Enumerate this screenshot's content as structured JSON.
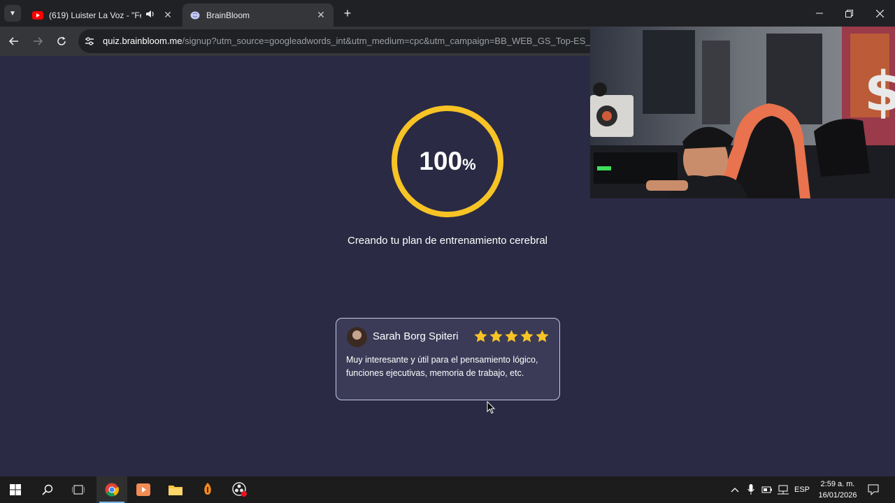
{
  "browser": {
    "tabs": [
      {
        "title": "(619) Luister La Voz - \"Feliz",
        "favicon": "youtube-icon",
        "audio": true,
        "active": false
      },
      {
        "title": "BrainBloom",
        "favicon": "brainbloom-icon",
        "audio": false,
        "active": true
      }
    ],
    "url": {
      "host": "quiz.brainbloom.me",
      "path": "/signup?utm_source=googleadwords_int&utm_medium=cpc&utm_campaign=BB_WEB_GS_Top-ES_t"
    }
  },
  "page": {
    "progress": {
      "value": 100,
      "number": "100",
      "unit": "%"
    },
    "status_text": "Creando tu plan de entrenamiento cerebral",
    "review": {
      "name": "Sarah Borg Spiteri",
      "rating": 5,
      "text": "Muy interesante y útil para el pensamiento lógico, funciones ejecutivas, memoria de trabajo, etc."
    },
    "colors": {
      "background": "#2a2a44",
      "accent": "#f7c325",
      "card": "#3b3b58"
    }
  },
  "taskbar": {
    "apps": [
      "windows-start-icon",
      "search-icon",
      "task-view-icon",
      "chrome-icon",
      "media-player-icon",
      "file-explorer-icon",
      "fl-studio-icon",
      "obs-icon"
    ],
    "tray": {
      "language": "ESP",
      "time": "2:59 a. m.",
      "date": "16/01/2026"
    }
  }
}
